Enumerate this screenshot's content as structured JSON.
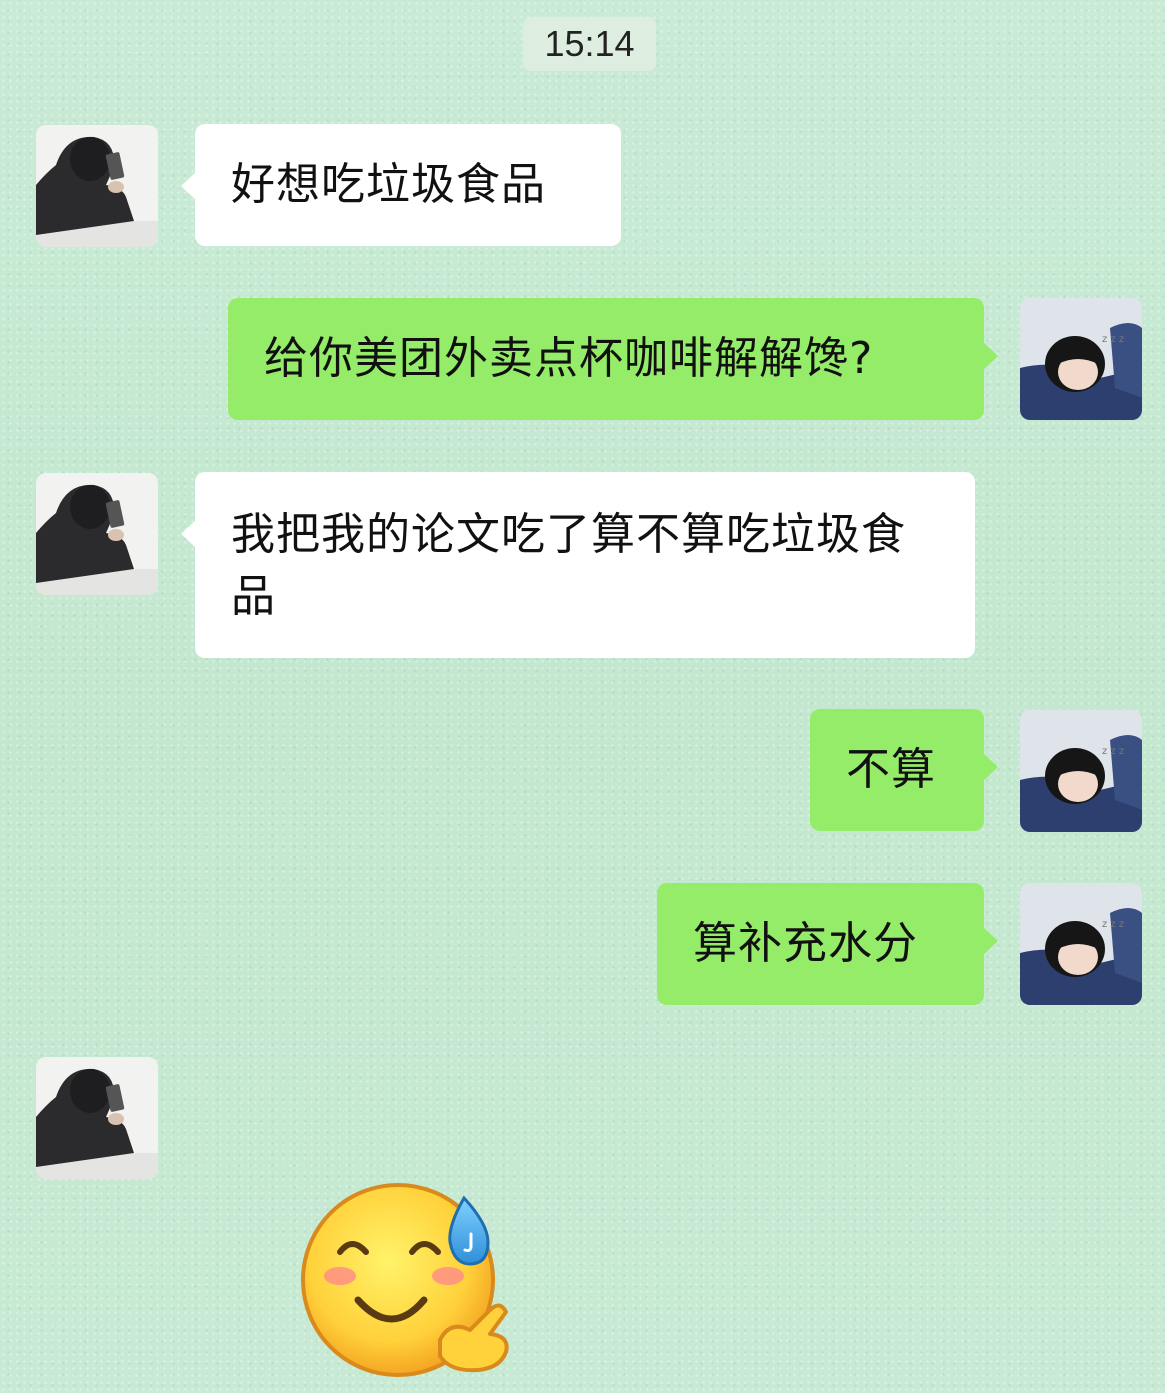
{
  "chat": {
    "timestamp": "15:14",
    "messages": [
      {
        "sender": "other",
        "text": "好想吃垃圾食品"
      },
      {
        "sender": "me",
        "text": "给你美团外卖点杯咖啡解解馋?"
      },
      {
        "sender": "other",
        "text": "我把我的论文吃了算不算吃垃圾食品"
      },
      {
        "sender": "me",
        "text": "不算"
      },
      {
        "sender": "me",
        "text": "算补充水分"
      },
      {
        "sender": "other",
        "sticker": "smiling-sweat-emoji"
      }
    ]
  },
  "colors": {
    "background": "#c6e9d3",
    "incoming_bubble": "#ffffff",
    "outgoing_bubble": "#95ec69",
    "timestamp_bg": "#ddeee1"
  }
}
